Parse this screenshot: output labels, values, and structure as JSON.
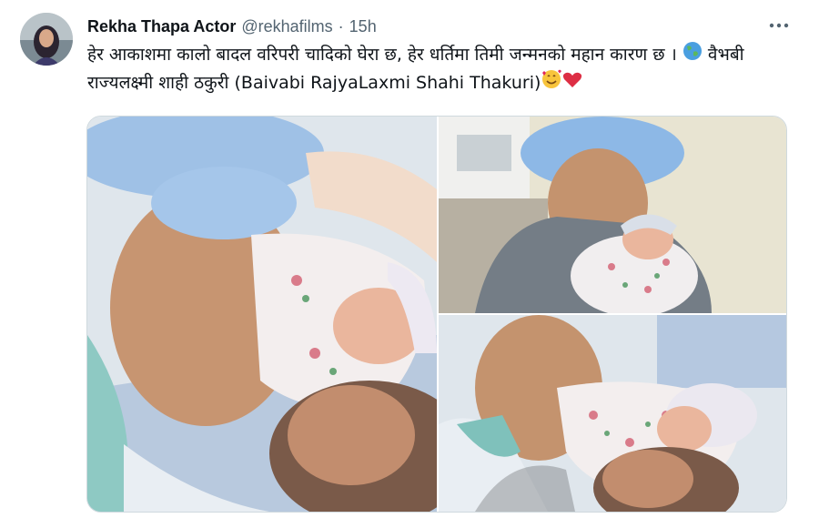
{
  "tweet": {
    "display_name": "Rekha Thapa Actor",
    "handle": "@rekhafilms",
    "separator": "·",
    "time": "15h",
    "text_part1": "हेर आकाशमा कालो बादल वरिपरी चादिको घेरा छ, हेर धर्तिमा तिमी जन्मनको महान कारण छ । ",
    "text_part2": " वैभबी राज्यलक्ष्मी शाही ठकुरी (Baivabi RajyaLaxmi Shahi Thakuri)",
    "icons": {
      "globe": "globe-emoji",
      "smile": "smiling-face-with-hearts-emoji",
      "heart": "red-heart-emoji",
      "more": "more-options-icon"
    },
    "media": [
      {
        "name": "photo-father-baby-closeup"
      },
      {
        "name": "photo-father-holding-baby"
      },
      {
        "name": "photo-parents-with-baby"
      }
    ]
  },
  "colors": {
    "text": "#0f1419",
    "secondary": "#536471",
    "border": "#cfd9de"
  }
}
